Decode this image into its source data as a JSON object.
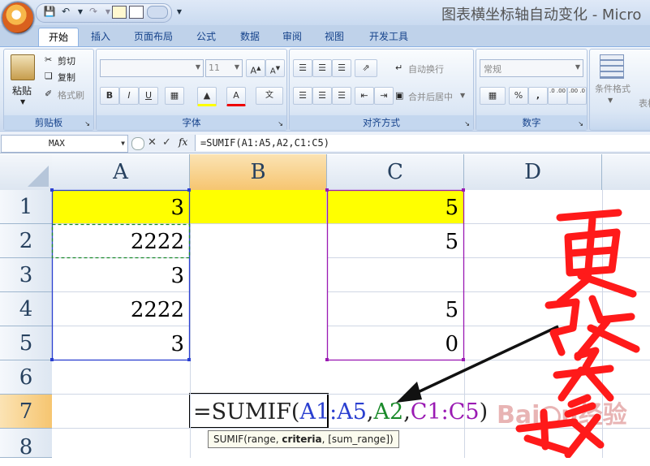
{
  "window": {
    "title": "图表横坐标轴自动变化 - Micro"
  },
  "tabs": [
    "开始",
    "插入",
    "页面布局",
    "公式",
    "数据",
    "审阅",
    "视图",
    "开发工具"
  ],
  "clipboard": {
    "paste": "粘贴",
    "cut": "剪切",
    "copy": "复制",
    "format_painter": "格式刷",
    "label": "剪贴板"
  },
  "font": {
    "name": "",
    "size": "11",
    "label": "字体"
  },
  "alignment": {
    "wrap": "自动换行",
    "merge": "合并后居中",
    "label": "对齐方式"
  },
  "number": {
    "format": "常规",
    "label": "数字",
    "percent": "%",
    "comma": ",",
    "inc_decimal": ".0 .00",
    "dec_decimal": ".00 .0"
  },
  "styles": {
    "conditional": "条件格式",
    "table_partial": "表格"
  },
  "formula_bar": {
    "name_box": "MAX",
    "formula": "=SUMIF(A1:A5,A2,C1:C5)"
  },
  "columns": [
    "A",
    "B",
    "C",
    "D"
  ],
  "rows": [
    "1",
    "2",
    "3",
    "4",
    "5",
    "6",
    "7",
    "8"
  ],
  "cells": {
    "A1": "3",
    "C1": "5",
    "A2": "2222",
    "C2": "5",
    "A3": "3",
    "C3": "",
    "A4": "2222",
    "C4": "5",
    "A5": "3",
    "C5": "0"
  },
  "edit_formula": {
    "eq": "=SUMIF(",
    "range": "A1:A5",
    "comma1": ",",
    "criteria": "A2",
    "comma2": ",",
    "sum_range": "C1:C5",
    "close": ")"
  },
  "tooltip": {
    "pre": "SUMIF(range, ",
    "bold": "criteria",
    "post": ", [sum_range])"
  },
  "annotation": {
    "handwritten": "更改参数",
    "watermark": "Baidu经验"
  },
  "colors": {
    "range": "#2a3fd0",
    "criteria": "#1a8a2a",
    "sum_range": "#9a1ab3",
    "highlight": "#ffff00",
    "ink": "#ff1a1a"
  }
}
